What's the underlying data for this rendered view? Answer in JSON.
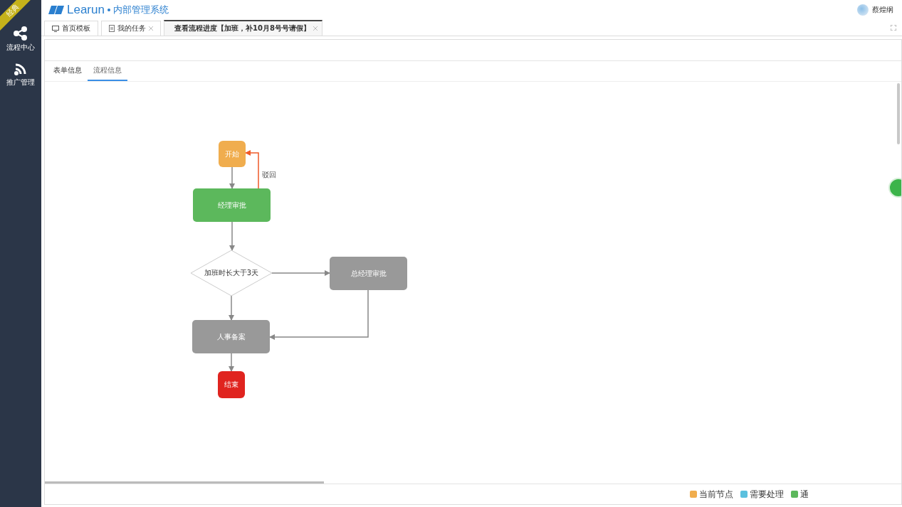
{
  "sidebar": {
    "ribbon": "经典",
    "items": [
      {
        "label": "流程中心"
      },
      {
        "label": "推广管理"
      }
    ]
  },
  "header": {
    "brand": "Learun",
    "subtitle": "内部管理系统",
    "user": "蔡煌纲"
  },
  "tabs": [
    {
      "label": "首页模板",
      "closable": false,
      "selected": false
    },
    {
      "label": "我的任务",
      "closable": true,
      "selected": false
    },
    {
      "label": "查看流程进度【加班，补10月8号号请假】",
      "closable": true,
      "selected": true
    }
  ],
  "subtabs": [
    {
      "label": "表单信息",
      "selected": false
    },
    {
      "label": "流程信息",
      "selected": true
    }
  ],
  "flow": {
    "nodes": [
      {
        "label": "开始",
        "kind": "start",
        "color": "#f0ad4e"
      },
      {
        "label": "经理审批",
        "kind": "task",
        "color": "#5cb85c"
      },
      {
        "label": "加班时长大于3天",
        "kind": "condition",
        "color": "#ffffff"
      },
      {
        "label": "总经理审批",
        "kind": "task",
        "color": "#999999"
      },
      {
        "label": "人事备案",
        "kind": "task",
        "color": "#999999"
      },
      {
        "label": "结束",
        "kind": "end",
        "color": "#e0241f"
      }
    ],
    "reject_label": "驳回"
  },
  "legend": [
    {
      "label": "当前节点",
      "color": "#f0ad4e"
    },
    {
      "label": "需要处理",
      "color": "#5bc0de"
    },
    {
      "label": "通",
      "color": "#5cb85c"
    }
  ]
}
